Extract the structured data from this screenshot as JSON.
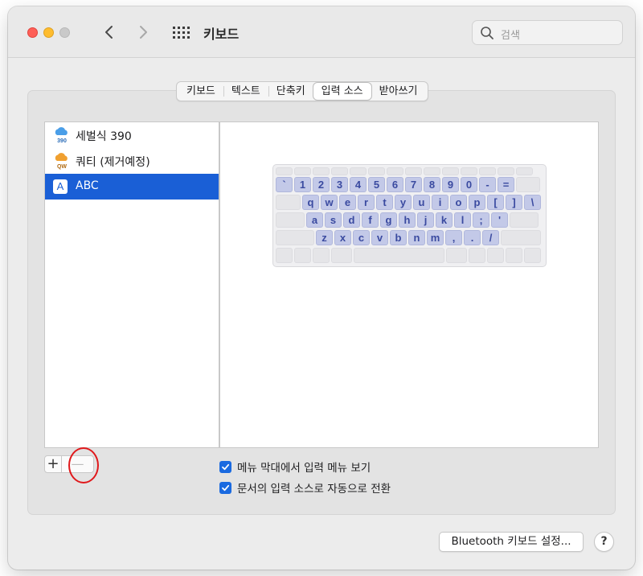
{
  "window": {
    "title": "키보드"
  },
  "search": {
    "placeholder": "검색"
  },
  "tabs": [
    {
      "label": "키보드",
      "selected": false
    },
    {
      "label": "텍스트",
      "selected": false
    },
    {
      "label": "단축키",
      "selected": false
    },
    {
      "label": "입력 소스",
      "selected": true
    },
    {
      "label": "받아쓰기",
      "selected": false
    }
  ],
  "input_sources": [
    {
      "label": "세벌식 390",
      "icon": "cloud-390-icon",
      "icon_text": "390",
      "icon_color": "#4a9ee8",
      "selected": false
    },
    {
      "label": "쿼티 (제거예정)",
      "icon": "cloud-qw-icon",
      "icon_text": "QW",
      "icon_color": "#f0a030",
      "selected": false
    },
    {
      "label": "ABC",
      "icon": "abc-icon",
      "icon_text": "A",
      "selected": true
    }
  ],
  "list_controls": {
    "add": "+",
    "remove": "—"
  },
  "keyboard_preview": {
    "rows": [
      [
        "`",
        "1",
        "2",
        "3",
        "4",
        "5",
        "6",
        "7",
        "8",
        "9",
        "0",
        "-",
        "="
      ],
      [
        "q",
        "w",
        "e",
        "r",
        "t",
        "y",
        "u",
        "i",
        "o",
        "p",
        "[",
        "]",
        "\\"
      ],
      [
        "a",
        "s",
        "d",
        "f",
        "g",
        "h",
        "j",
        "k",
        "l",
        ";",
        "'"
      ],
      [
        "z",
        "x",
        "c",
        "v",
        "b",
        "n",
        "m",
        ",",
        ".",
        "/"
      ]
    ]
  },
  "checkboxes": [
    {
      "label": "메뉴 막대에서 입력 메뉴 보기",
      "checked": true
    },
    {
      "label": "문서의 입력 소스로 자동으로 전환",
      "checked": true
    }
  ],
  "footer": {
    "bluetooth_button": "Bluetooth 키보드 설정...",
    "help": "?"
  },
  "colors": {
    "accent": "#1a5fd6",
    "checkbox": "#1a6ae0",
    "annotation": "#e0181b"
  }
}
